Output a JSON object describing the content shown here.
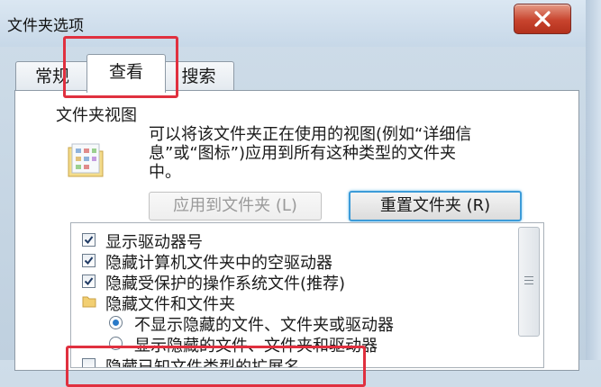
{
  "window": {
    "title": "文件夹选项"
  },
  "tabs": [
    {
      "label": "常规"
    },
    {
      "label": "查看"
    },
    {
      "label": "搜索"
    }
  ],
  "folder_views": {
    "heading": "文件夹视图",
    "description_line1": "可以将该文件夹正在使用的视图(例如“详细信",
    "description_line2": "息”或“图标”)应用到所有这种类型的文件夹",
    "description_line3": "中。",
    "apply_button": "应用到文件夹 (L)",
    "reset_button": "重置文件夹 (R)"
  },
  "settings": [
    {
      "type": "checkbox",
      "checked": true,
      "label": "显示驱动器号"
    },
    {
      "type": "checkbox",
      "checked": true,
      "label": "隐藏计算机文件夹中的空驱动器"
    },
    {
      "type": "checkbox",
      "checked": true,
      "label": "隐藏受保护的操作系统文件(推荐)"
    },
    {
      "type": "folder",
      "label": "隐藏文件和文件夹"
    },
    {
      "type": "radio",
      "selected": true,
      "label": "不显示隐藏的文件、文件夹或驱动器"
    },
    {
      "type": "radio",
      "selected": false,
      "label": "显示隐藏的文件、文件夹和驱动器"
    },
    {
      "type": "checkbox",
      "checked": false,
      "label": "隐藏已知文件类型的扩展名"
    }
  ],
  "colors": {
    "highlight_box": "#e0303f",
    "focus": "#3c9bd8",
    "titlebar": "#c7d8e8"
  }
}
